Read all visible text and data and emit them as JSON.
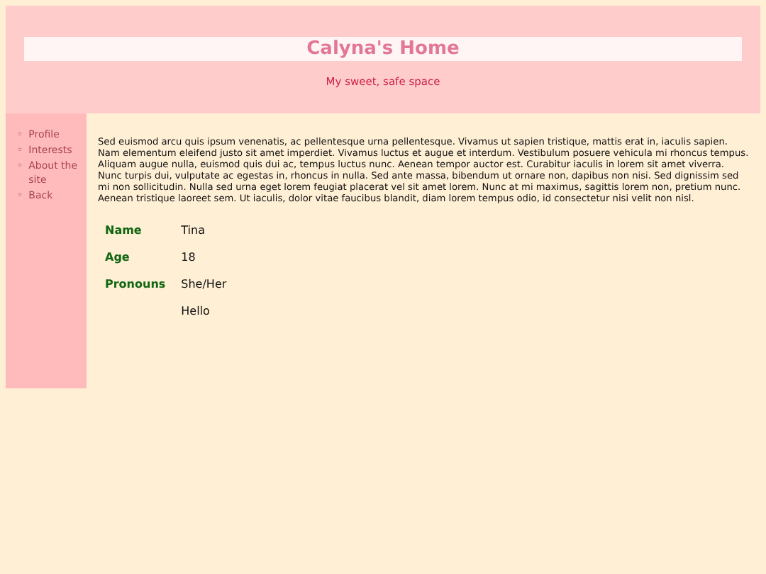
{
  "header": {
    "title": "Calyna's Home",
    "subtitle": "My sweet, safe space"
  },
  "sidebar": {
    "items": [
      {
        "marker": "◦",
        "label": "Profile"
      },
      {
        "marker": "◦",
        "label": "Interests"
      },
      {
        "marker": "◦",
        "label": "About the site"
      },
      {
        "marker": "◦",
        "label": "Back"
      }
    ]
  },
  "content": {
    "paragraphs": [
      "Sed euismod arcu quis ipsum venenatis, ac pellentesque urna pellentesque. Vivamus ut sapien tristique, mattis erat in, iaculis sapien. Nam elementum eleifend justo sit amet imperdiet. Vivamus luctus et augue et interdum. Vestibulum posuere vehicula mi rhoncus tempus. Aliquam augue nulla, euismod quis dui ac, tempus luctus nunc. Aenean tempor auctor est. Curabitur iaculis in lorem sit amet viverra.",
      "Nunc turpis dui, vulputate ac egestas in, rhoncus in nulla. Sed ante massa, bibendum ut ornare non, dapibus non nisi. Sed dignissim sed mi non sollicitudin. Nulla sed urna eget lorem feugiat placerat vel sit amet lorem. Nunc at mi maximus, sagittis lorem non, pretium nunc. Aenean tristique laoreet sem. Ut iaculis, dolor vitae faucibus blandit, diam lorem tempus odio, id consectetur nisi velit non nisl."
    ],
    "table": {
      "rows": [
        {
          "label": "Name",
          "value": "Tina"
        },
        {
          "label": "Age",
          "value": "18"
        },
        {
          "label": "Pronouns",
          "value": "She/Her"
        },
        {
          "value": "Hello"
        }
      ]
    }
  }
}
